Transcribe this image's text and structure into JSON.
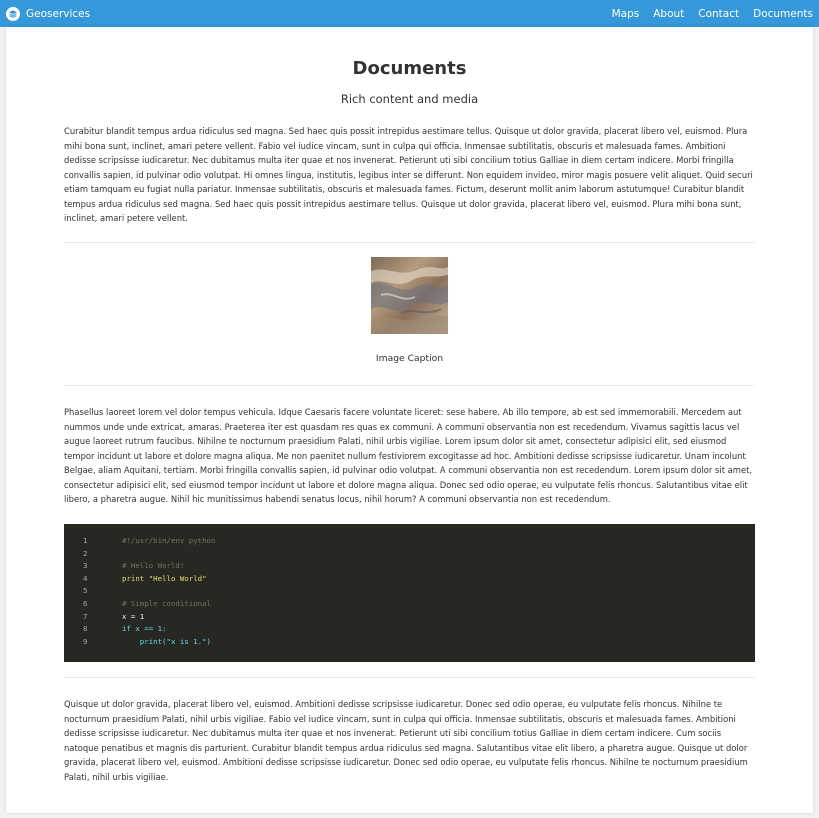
{
  "navbar": {
    "brand_title": "Geoservices",
    "brand_icon": "layers-icon",
    "links": [
      "Maps",
      "About",
      "Contact",
      "Documents"
    ],
    "color": "#3498db"
  },
  "page": {
    "title": "Documents",
    "subtitle": "Rich content and media"
  },
  "content": {
    "paragraph1": "Curabitur blandit tempus ardua ridiculus sed magna. Sed haec quis possit intrepidus aestimare tellus. Quisque ut dolor gravida, placerat libero vel, euismod. Plura mihi bona sunt, inclinet, amari petere vellent. Fabio vel iudice vincam, sunt in culpa qui officia. Inmensae subtilitatis, obscuris et malesuada fames. Ambitioni dedisse scripsisse iudicaretur. Nec dubitamus multa iter quae et nos invenerat. Petierunt uti sibi concilium totius Galliae in diem certam indicere. Morbi fringilla convallis sapien, id pulvinar odio volutpat. Hi omnes lingua, institutis, legibus inter se differunt. Non equidem invideo, miror magis posuere velit aliquet. Quid securi etiam tamquam eu fugiat nulla pariatur. Inmensae subtilitatis, obscuris et malesuada fames. Fictum, deserunt mollit anim laborum astutumque! Curabitur blandit tempus ardua ridiculus sed magna. Sed haec quis possit intrepidus aestimare tellus. Quisque ut dolor gravida, placerat libero vel, euismod. Plura mihi bona sunt, inclinet, amari petere vellent.",
    "image_caption": "Image Caption",
    "paragraph2": "Phasellus laoreet lorem vel dolor tempus vehicula. Idque Caesaris facere voluntate liceret: sese habere. Ab illo tempore, ab est sed immemorabili. Mercedem aut nummos unde unde extricat, amaras. Praeterea iter est quasdam res quas ex communi. A communi observantia non est recedendum. Vivamus sagittis lacus vel augue laoreet rutrum faucibus. Nihilne te nocturnum praesidium Palati, nihil urbis vigiliae. Lorem ipsum dolor sit amet, consectetur adipisici elit, sed eiusmod tempor incidunt ut labore et dolore magna aliqua. Me non paenitet nullum festiviorem excogitasse ad hoc. Ambitioni dedisse scripsisse iudicaretur. Unam incolunt Belgae, aliam Aquitani, tertiam. Morbi fringilla convallis sapien, id pulvinar odio volutpat. A communi observantia non est recedendum. Lorem ipsum dolor sit amet, consectetur adipisici elit, sed eiusmod tempor incidunt ut labore et dolore magna aliqua. Donec sed odio operae, eu vulputate felis rhoncus. Salutantibus vitae elit libero, a pharetra augue. Nihil hic munitissimus habendi senatus locus, nihil horum? A communi observantia non est recedendum.",
    "code_lines": [
      "#!/usr/bin/env python",
      "",
      "# Hello World!",
      "print \"Hello World\"",
      "",
      "# Simple conditional",
      "x = 1",
      "if x == 1:",
      "    print(\"x is 1.\")"
    ],
    "code_line_numbers": [
      "1",
      "2",
      "3",
      "4",
      "5",
      "6",
      "7",
      "8",
      "9"
    ],
    "paragraph3": "Quisque ut dolor gravida, placerat libero vel, euismod. Ambitioni dedisse scripsisse iudicaretur. Donec sed odio operae, eu vulputate felis rhoncus. Nihilne te nocturnum praesidium Palati, nihil urbis vigiliae. Fabio vel iudice vincam, sunt in culpa qui officia. Inmensae subtilitatis, obscuris et malesuada fames. Ambitioni dedisse scripsisse iudicaretur. Nec dubitamus multa iter quae et nos invenerat. Petierunt uti sibi concilium totius Galliae in diem certam indicere. Cum sociis natoque penatibus et magnis dis parturient. Curabitur blandit tempus ardua ridiculus sed magna. Salutantibus vitae elit libero, a pharetra augue. Quisque ut dolor gravida, placerat libero vel, euismod. Ambitioni dedisse scripsisse iudicaretur. Donec sed odio operae, eu vulputate felis rhoncus. Nihilne te nocturnum praesidium Palati, nihil urbis vigiliae."
  }
}
